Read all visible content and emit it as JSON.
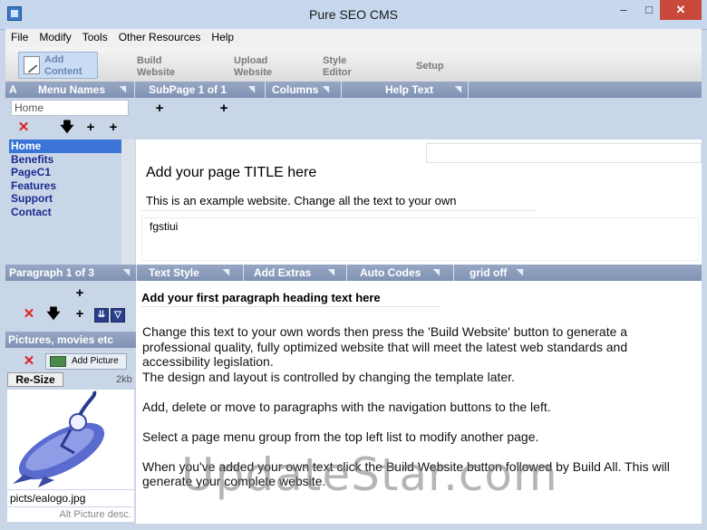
{
  "window": {
    "title": "Pure SEO CMS",
    "minimize": "–",
    "maximize": "□",
    "close": "✕"
  },
  "menu": [
    "File",
    "Modify",
    "Tools",
    "Other Resources",
    "Help"
  ],
  "toolbar": {
    "add_content": [
      "Add",
      "Content"
    ],
    "build_website": [
      "Build",
      "Website"
    ],
    "upload_website": [
      "Upload",
      "Website"
    ],
    "style_editor": [
      "Style",
      "Editor"
    ],
    "setup": "Setup"
  },
  "top_strip": {
    "a": "A",
    "menu_names": "Menu Names",
    "subpage": "SubPage 1 of 1",
    "columns": "Columns",
    "help_text": "Help Text"
  },
  "menu_name_input": "Home",
  "pages": [
    "Home",
    "Benefits",
    "PageC1",
    "Features",
    "Support",
    "Contact"
  ],
  "page_content": {
    "title_field": "Add your page TITLE here",
    "description_field": "This is an example website. Change all the text to your own",
    "keywords_field": "fgstiui"
  },
  "para_strip": {
    "paragraph": "Paragraph 1 of 3",
    "text_style": "Text Style",
    "add_extras": "Add Extras",
    "auto_codes": "Auto Codes",
    "grid": "grid off"
  },
  "pictures": {
    "header": "Pictures, movies etc",
    "add_picture": "Add Picture",
    "resize": "Re-Size",
    "size": "2kb",
    "filename": "picts/ealogo.jpg",
    "alt": "Alt Picture desc."
  },
  "paragraph": {
    "heading": "Add your first paragraph heading text here",
    "lines": [
      "Change this text to your own words then press the 'Build Website' button to generate a",
      "professional quality,  fully optimized website that will meet the latest web standards and",
      "accessibility legislation.",
      "The design and layout is controlled by changing the template later.",
      "",
      "Add, delete or move to paragraphs with the navigation buttons to the left.",
      "",
      "Select a page menu group from the top left list to modify another page.",
      "",
      "When you've added your own text click the Build Website button followed by Build All. This will",
      "generate your complete website."
    ]
  },
  "watermark": "UpdateStar.com",
  "colors": {
    "strip": "#8a9bbb",
    "selection": "#3a74d6",
    "link": "#1b2b8e",
    "close": "#c9483c"
  }
}
